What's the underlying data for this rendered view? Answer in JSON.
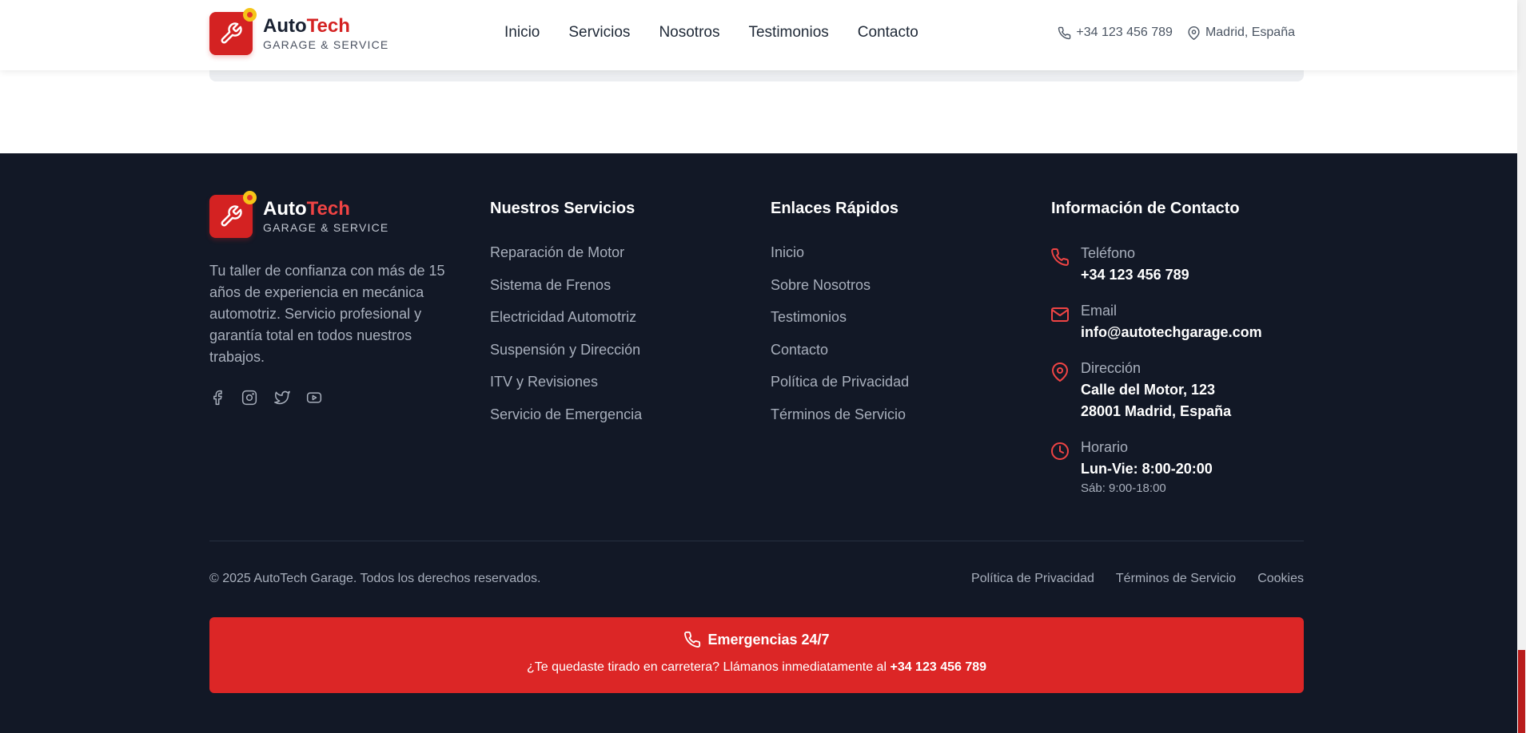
{
  "brand": {
    "name_part1": "Auto",
    "name_part2": "Tech",
    "tagline": "GARAGE & SERVICE"
  },
  "nav": [
    "Inicio",
    "Servicios",
    "Nosotros",
    "Testimonios",
    "Contacto"
  ],
  "header_contact": {
    "phone": "+34 123 456 789",
    "location": "Madrid, España"
  },
  "footer": {
    "description": "Tu taller de confianza con más de 15 años de experiencia en mecánica automotriz. Servicio profesional y garantía total en todos nuestros trabajos.",
    "social_icons": [
      "facebook-icon",
      "instagram-icon",
      "twitter-icon",
      "youtube-icon"
    ],
    "services": {
      "title": "Nuestros Servicios",
      "items": [
        "Reparación de Motor",
        "Sistema de Frenos",
        "Electricidad Automotriz",
        "Suspensión y Dirección",
        "ITV y Revisiones",
        "Servicio de Emergencia"
      ]
    },
    "links": {
      "title": "Enlaces Rápidos",
      "items": [
        "Inicio",
        "Sobre Nosotros",
        "Testimonios",
        "Contacto",
        "Política de Privacidad",
        "Términos de Servicio"
      ]
    },
    "contact": {
      "title": "Información de Contacto",
      "phone_label": "Teléfono",
      "phone": "+34 123 456 789",
      "email_label": "Email",
      "email": "info@autotechgarage.com",
      "address_label": "Dirección",
      "address_line1": "Calle del Motor, 123",
      "address_line2": "28001 Madrid, España",
      "hours_label": "Horario",
      "hours_weekday": "Lun-Vie: 8:00-20:00",
      "hours_saturday": "Sáb: 9:00-18:00"
    },
    "copyright": "© 2025 AutoTech Garage. Todos los derechos reservados.",
    "legal": [
      "Política de Privacidad",
      "Términos de Servicio",
      "Cookies"
    ],
    "emergency": {
      "title": "Emergencias 24/7",
      "text": "¿Te quedaste tirado en carretera? Llámanos inmediatamente al",
      "phone": "+34 123 456 789"
    }
  },
  "colors": {
    "accent": "#dc2626",
    "footer_bg": "#121826",
    "text_muted": "#a8afbc"
  }
}
